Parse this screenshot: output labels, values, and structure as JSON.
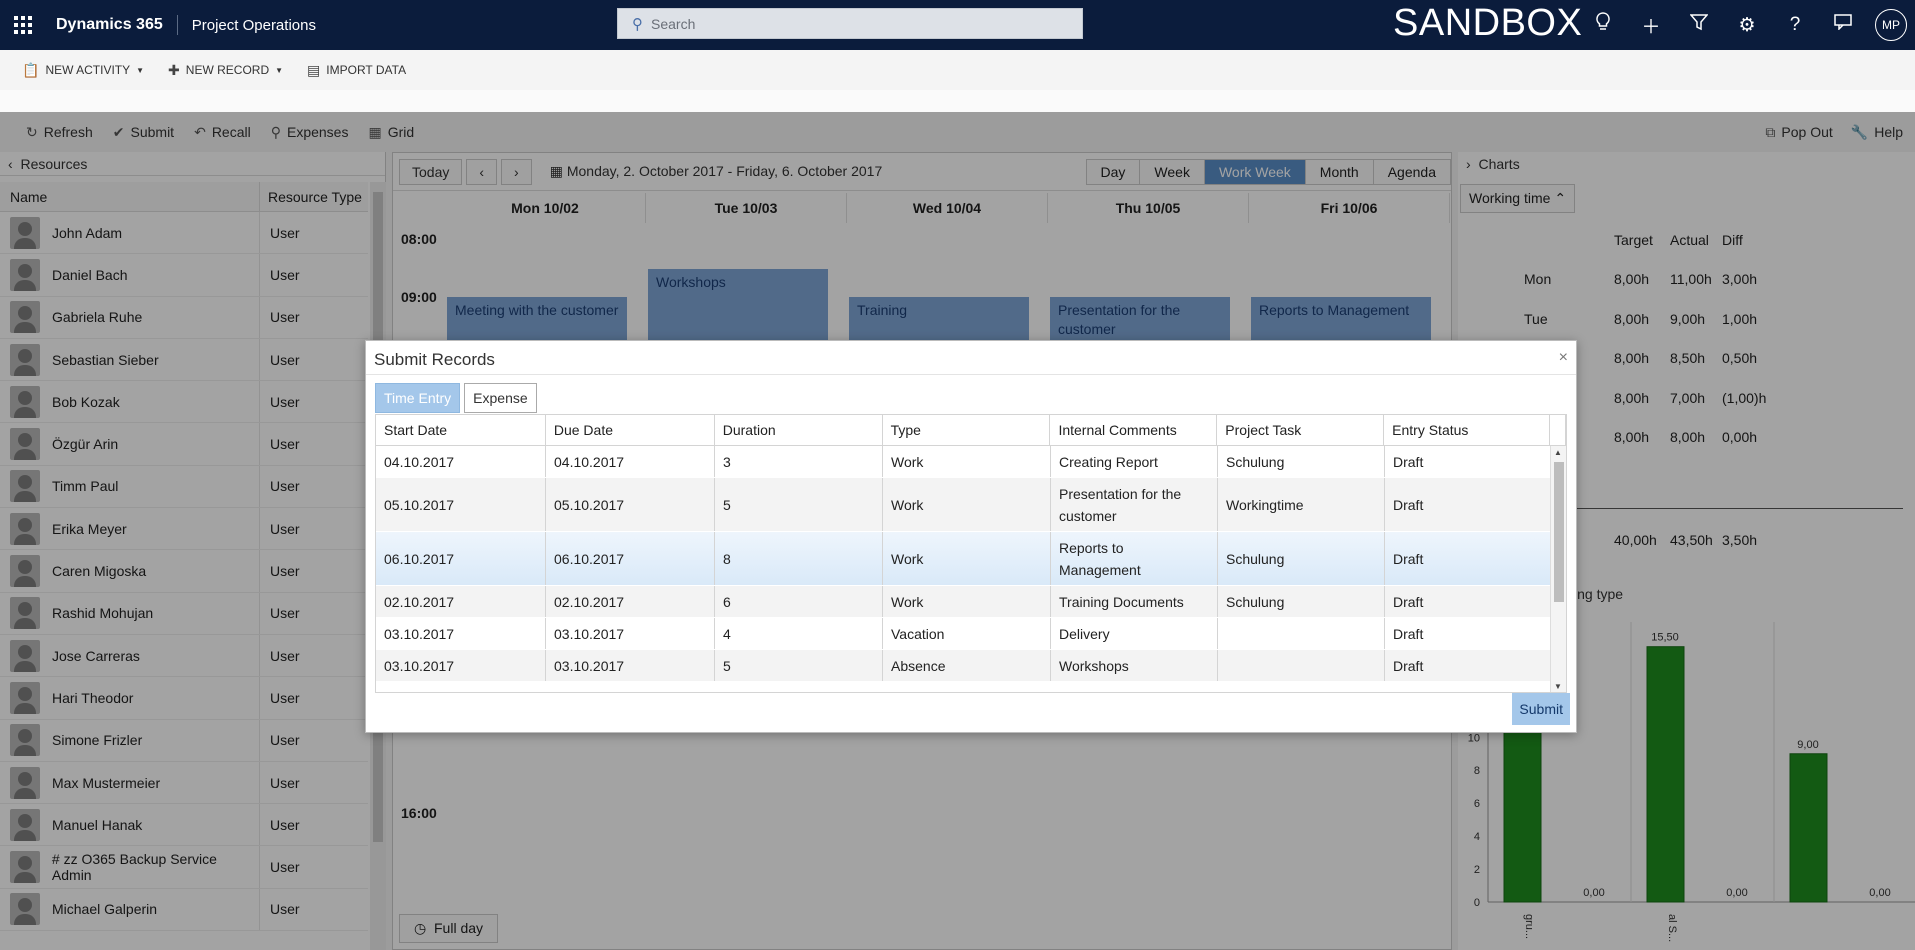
{
  "topbar": {
    "brand": "Dynamics 365",
    "module": "Project Operations",
    "search_placeholder": "Search",
    "environment": "SANDBOX",
    "avatar_initials": "MP",
    "icons": [
      "lightbulb-icon",
      "plus-icon",
      "filter-icon",
      "gear-icon",
      "help-icon",
      "chat-icon"
    ]
  },
  "commandbar": {
    "new_activity": "NEW ACTIVITY",
    "new_record": "NEW RECORD",
    "import_data": "IMPORT DATA"
  },
  "toolbar": {
    "refresh": "Refresh",
    "submit": "Submit",
    "recall": "Recall",
    "expenses": "Expenses",
    "grid": "Grid",
    "pop_out": "Pop Out",
    "help": "Help"
  },
  "resources": {
    "title": "Resources",
    "col_name": "Name",
    "col_type": "Resource Type",
    "rows": [
      {
        "name": "John Adam",
        "type": "User"
      },
      {
        "name": "Daniel Bach",
        "type": "User"
      },
      {
        "name": "Gabriela Ruhe",
        "type": "User"
      },
      {
        "name": "Sebastian Sieber",
        "type": "User"
      },
      {
        "name": "Bob Kozak",
        "type": "User"
      },
      {
        "name": "Özgür Arin",
        "type": "User"
      },
      {
        "name": "Timm Paul",
        "type": "User"
      },
      {
        "name": "Erika Meyer",
        "type": "User"
      },
      {
        "name": "Caren Migoska",
        "type": "User"
      },
      {
        "name": "Rashid Mohujan",
        "type": "User"
      },
      {
        "name": "Jose Carreras",
        "type": "User"
      },
      {
        "name": "Hari Theodor",
        "type": "User"
      },
      {
        "name": "Simone Frizler",
        "type": "User"
      },
      {
        "name": "Max Mustermeier",
        "type": "User"
      },
      {
        "name": "Manuel Hanak",
        "type": "User"
      },
      {
        "name": "# zz O365 Backup Service Admin",
        "type": "User"
      },
      {
        "name": "Michael Galperin",
        "type": "User"
      }
    ]
  },
  "calendar": {
    "today": "Today",
    "range": "Monday, 2. October 2017 - Friday, 6. October 2017",
    "views": [
      "Day",
      "Week",
      "Work Week",
      "Month",
      "Agenda"
    ],
    "active_view": "Work Week",
    "days": [
      "Mon 10/02",
      "Tue 10/03",
      "Wed 10/04",
      "Thu 10/05",
      "Fri 10/06"
    ],
    "times": [
      "08:00",
      "09:00",
      "16:00"
    ],
    "events": [
      "Meeting with the customer",
      "Workshops",
      "Training",
      "Presentation for the customer",
      "Reports to Management"
    ],
    "full_day": "Full day"
  },
  "charts": {
    "title": "Charts",
    "selector": "Working time",
    "stats_headers": [
      "Target",
      "Actual",
      "Diff"
    ],
    "stats_rows": [
      {
        "day": "Mon",
        "target": "8,00h",
        "actual": "11,00h",
        "diff": "3,00h"
      },
      {
        "day": "Tue",
        "target": "8,00h",
        "actual": "9,00h",
        "diff": "1,00h"
      },
      {
        "day": "",
        "target": "8,00h",
        "actual": "8,50h",
        "diff": "0,50h"
      },
      {
        "day": "",
        "target": "8,00h",
        "actual": "7,00h",
        "diff": "(1,00)h"
      },
      {
        "day": "",
        "target": "8,00h",
        "actual": "8,00h",
        "diff": "0,00h"
      }
    ],
    "stats_total": {
      "target": "40,00h",
      "actual": "43,50h",
      "diff": "3,50h"
    },
    "chart_caption": "ing type",
    "chart_data": {
      "type": "bar",
      "ylim": [
        0,
        17
      ],
      "yticks": [
        0,
        2,
        4,
        6,
        8,
        10,
        12
      ],
      "groups": [
        {
          "label": "gru...",
          "values": [
            14,
            0
          ],
          "labels": [
            "",
            "0,00"
          ]
        },
        {
          "label": "al S...",
          "values": [
            15.5,
            0
          ],
          "labels": [
            "15,50",
            "0,00"
          ]
        },
        {
          "label": "",
          "values": [
            9,
            0
          ],
          "labels": [
            "9,00",
            "0,00"
          ]
        }
      ],
      "color": "#1e8e1e"
    }
  },
  "modal": {
    "title": "Submit Records",
    "tabs": [
      "Time Entry",
      "Expense"
    ],
    "active_tab": "Time Entry",
    "columns": [
      "Start Date",
      "Due Date",
      "Duration",
      "Type",
      "Internal Comments",
      "Project Task",
      "Entry Status"
    ],
    "rows": [
      {
        "start": "04.10.2017",
        "due": "04.10.2017",
        "duration": "3",
        "type": "Work",
        "comments": "Creating Report",
        "task": "Schulung",
        "status": "Draft"
      },
      {
        "start": "05.10.2017",
        "due": "05.10.2017",
        "duration": "5",
        "type": "Work",
        "comments": "Presentation for the customer",
        "task": "Workingtime",
        "status": "Draft"
      },
      {
        "start": "06.10.2017",
        "due": "06.10.2017",
        "duration": "8",
        "type": "Work",
        "comments": "Reports to Management",
        "task": "Schulung",
        "status": "Draft"
      },
      {
        "start": "02.10.2017",
        "due": "02.10.2017",
        "duration": "6",
        "type": "Work",
        "comments": "Training Documents",
        "task": "Schulung",
        "status": "Draft"
      },
      {
        "start": "03.10.2017",
        "due": "03.10.2017",
        "duration": "4",
        "type": "Vacation",
        "comments": "Delivery",
        "task": "",
        "status": "Draft"
      },
      {
        "start": "03.10.2017",
        "due": "03.10.2017",
        "duration": "5",
        "type": "Absence",
        "comments": "Workshops",
        "task": "",
        "status": "Draft"
      }
    ],
    "submit": "Submit"
  }
}
